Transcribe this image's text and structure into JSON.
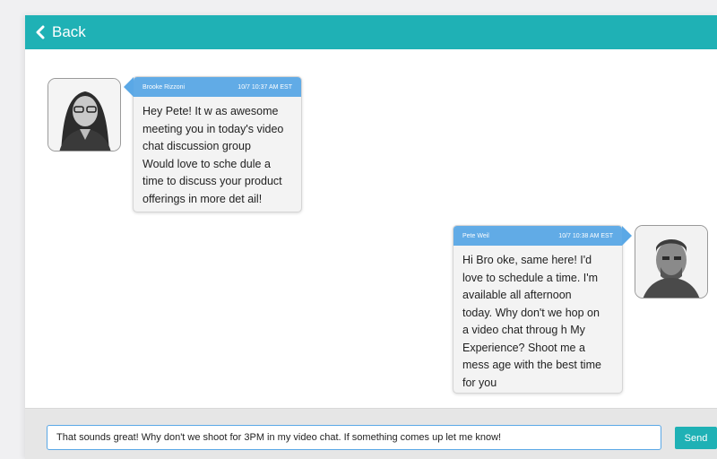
{
  "header": {
    "back_label": "Back",
    "back_icon": "chevron-left-icon"
  },
  "messages": [
    {
      "sender": "Brooke Rizzoni",
      "timestamp": "10/7 10:37 AM EST",
      "text": "Hey Pete! It was awesome meeting you in today's video chat discussion group. Would love to schedule a time to discuss your product offerings in more detail!",
      "lines": [
        "Hey Pete! It w as awesome",
        "meeting you in today's video",
        "chat discussion group",
        "Would love to sche dule a",
        "time to discuss your product",
        "offerings in more det ail!"
      ]
    },
    {
      "sender": "Pete Weil",
      "timestamp": "10/7 10:38 AM EST",
      "lines": [
        "Hi Bro oke, same here! I'd",
        "love to schedule a time. I'm",
        "available all afternoon",
        "today. Why don't we hop on",
        "a video chat throug h My",
        "Experience? Shoot me a",
        "mess age with the best time",
        "for you"
      ]
    }
  ],
  "composer": {
    "value": "That sounds great! Why don't we shoot for 3PM in my video chat. If something comes up let me know!",
    "send_label": "Send"
  },
  "colors": {
    "accent": "#1fb1b5",
    "bubble_header": "#5aa8e6",
    "bubble_bg": "#f3f3f3"
  }
}
